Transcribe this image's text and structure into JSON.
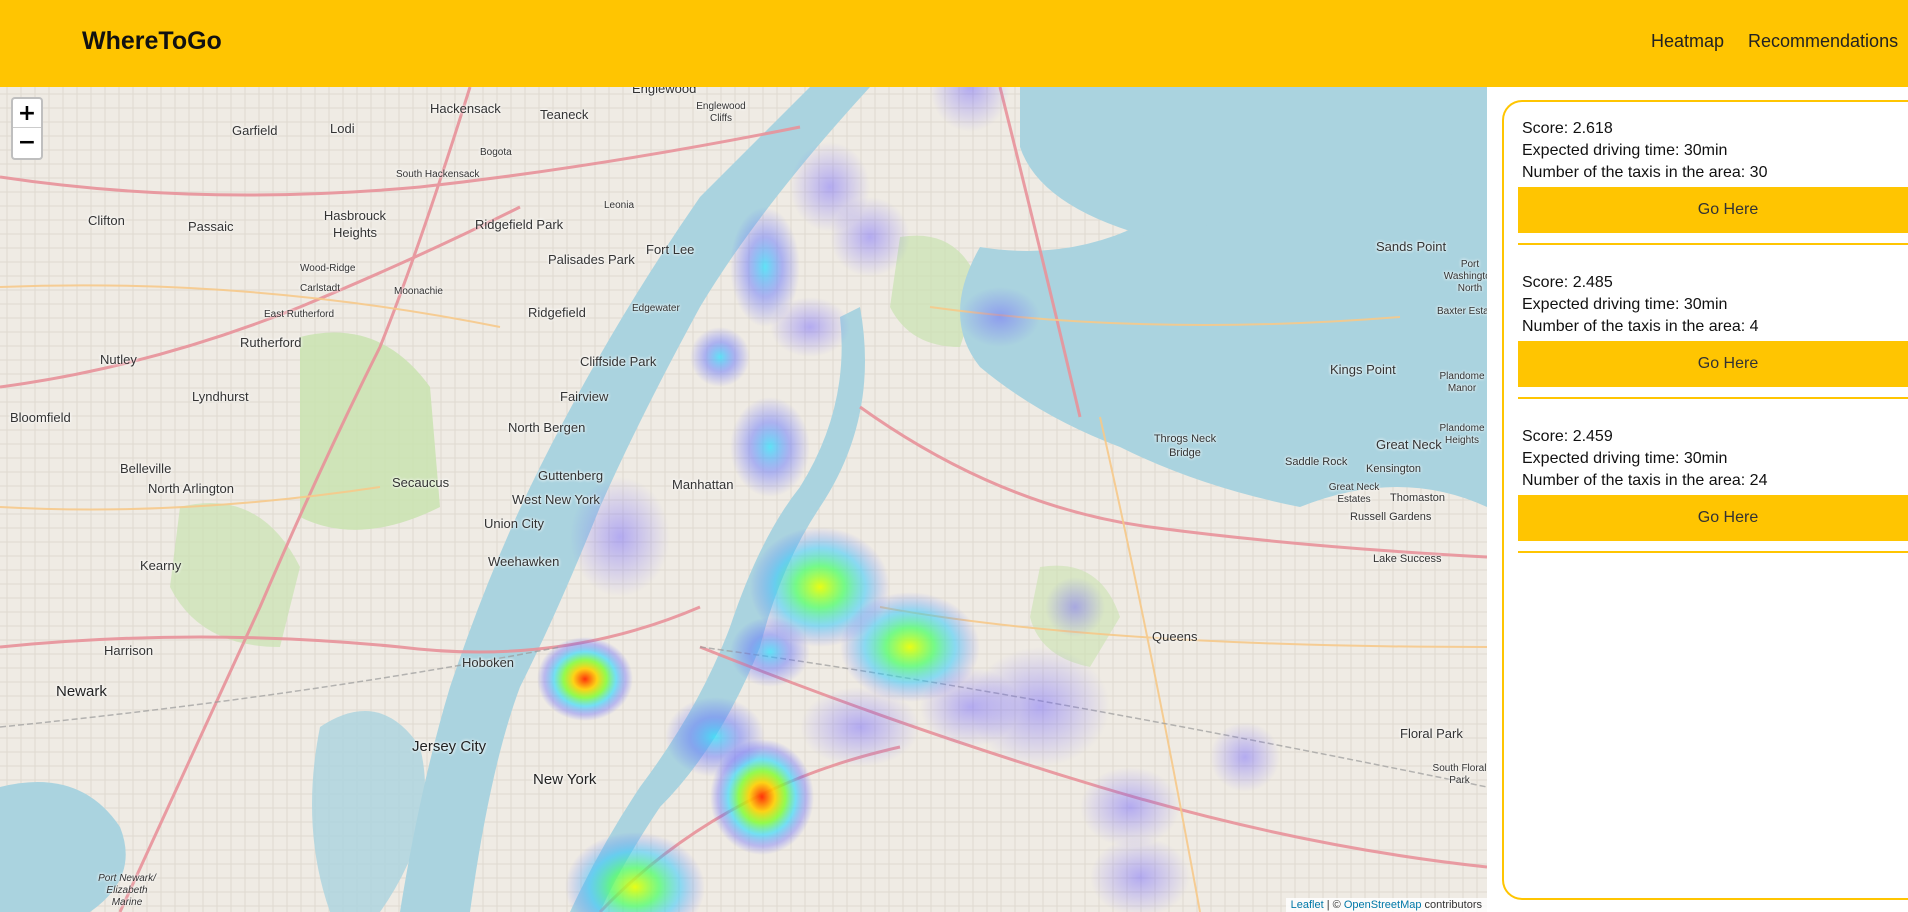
{
  "navbar": {
    "brand": "WhereToGo",
    "links": [
      "Heatmap",
      "Recommendations"
    ],
    "color": "#ffc501"
  },
  "map": {
    "zoom_in": "+",
    "zoom_out": "−",
    "attribution": {
      "leaflet": "Leaflet",
      "sep": " | © ",
      "osm": "OpenStreetMap",
      "suffix": " contributors"
    },
    "places": [
      "Englewood",
      "Hackensack",
      "Teaneck",
      "Garfield",
      "Lodi",
      "Clifton",
      "Passaic",
      "Hasbrouck Heights",
      "Ridgefield Park",
      "Fort Lee",
      "Palisades Park",
      "Rutherford",
      "Ridgefield",
      "Nutley",
      "Cliffside Park",
      "Lyndhurst",
      "Fairview",
      "Bloomfield",
      "North Bergen",
      "Belleville",
      "Guttenberg",
      "North Arlington",
      "Secaucus",
      "West New York",
      "Union City",
      "Weehawken",
      "Manhattan",
      "Kearny",
      "Harrison",
      "Hoboken",
      "Newark",
      "Jersey City",
      "New York",
      "Queens",
      "Great Neck",
      "Kings Point",
      "Sands Point",
      "Floral Park",
      "Throgs Neck Bridge",
      "Russell Gardens",
      "Lake Success",
      "Saddle Rock",
      "Kensington",
      "Thomaston",
      "Moonachie",
      "Carlstadt",
      "Wood-Ridge",
      "East Rutherford",
      "Bogota",
      "Leonia",
      "Edgewater",
      "South Hackensack",
      "Englewood Cliffs",
      "Port Washington North",
      "Baxter Estates",
      "Plandome Manor",
      "Plandome Heights",
      "Great Neck Estates",
      "South Floral Park",
      "Port Newark/ Elizabeth Marine"
    ]
  },
  "recommendations": [
    {
      "score": "Score: 2.618",
      "time": "Expected driving time: 30min",
      "taxis": "Number of the taxis in the area: 30",
      "button": "Go Here"
    },
    {
      "score": "Score: 2.485",
      "time": "Expected driving time: 30min",
      "taxis": "Number of the taxis in the area: 4",
      "button": "Go Here"
    },
    {
      "score": "Score: 2.459",
      "time": "Expected driving time: 30min",
      "taxis": "Number of the taxis in the area: 24",
      "button": "Go Here"
    }
  ]
}
